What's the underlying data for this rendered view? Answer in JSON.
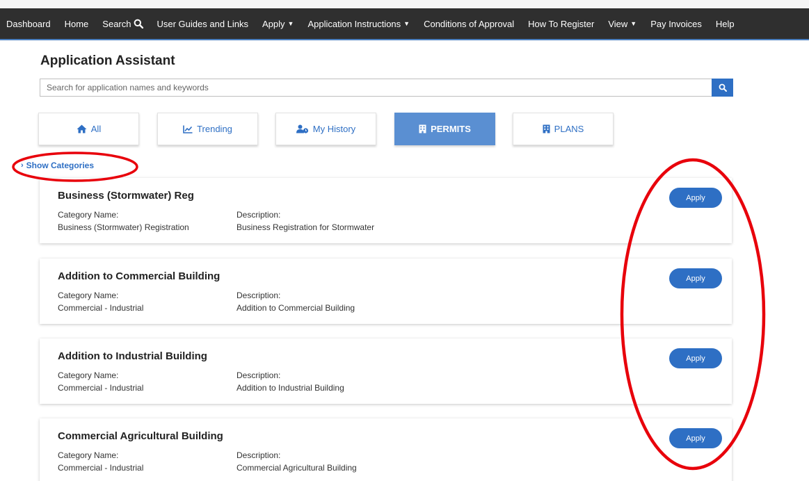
{
  "nav": {
    "items": [
      {
        "label": "Dashboard",
        "caret": false,
        "search_icon": false
      },
      {
        "label": "Home",
        "caret": false,
        "search_icon": false
      },
      {
        "label": "Search",
        "caret": false,
        "search_icon": true
      },
      {
        "label": "User Guides and Links",
        "caret": false,
        "search_icon": false
      },
      {
        "label": "Apply",
        "caret": true,
        "search_icon": false
      },
      {
        "label": "Application Instructions",
        "caret": true,
        "search_icon": false
      },
      {
        "label": "Conditions of Approval",
        "caret": false,
        "search_icon": false
      },
      {
        "label": "How To Register",
        "caret": false,
        "search_icon": false
      },
      {
        "label": "View",
        "caret": true,
        "search_icon": false
      },
      {
        "label": "Pay Invoices",
        "caret": false,
        "search_icon": false
      },
      {
        "label": "Help",
        "caret": false,
        "search_icon": false
      }
    ]
  },
  "page": {
    "title": "Application Assistant"
  },
  "search": {
    "placeholder": "Search for application names and keywords",
    "value": ""
  },
  "tabs": [
    {
      "label": "All",
      "icon": "home-icon",
      "active": false
    },
    {
      "label": "Trending",
      "icon": "trending-chart-icon",
      "active": false
    },
    {
      "label": "My History",
      "icon": "user-history-icon",
      "active": false
    },
    {
      "label": "PERMITS",
      "icon": "building-icon",
      "active": true
    },
    {
      "label": "PLANS",
      "icon": "building-icon",
      "active": false
    }
  ],
  "categories_toggle": {
    "label": "Show Categories"
  },
  "field_labels": {
    "category": "Category Name:",
    "description": "Description:"
  },
  "apply_label": "Apply",
  "applications": [
    {
      "title": "Business (Stormwater) Reg",
      "category": "Business (Stormwater) Registration",
      "description": "Business Registration for Stormwater"
    },
    {
      "title": "Addition to Commercial Building",
      "category": "Commercial - Industrial",
      "description": "Addition to Commercial Building"
    },
    {
      "title": "Addition to Industrial Building",
      "category": "Commercial - Industrial",
      "description": "Addition to Industrial Building"
    },
    {
      "title": "Commercial Agricultural Building",
      "category": "Commercial - Industrial",
      "description": "Commercial Agricultural Building"
    }
  ],
  "colors": {
    "accent": "#2e6fc4",
    "active_tab": "#5a8fd2",
    "navbar": "#2f2f2f",
    "annotation": "#e8000b"
  }
}
